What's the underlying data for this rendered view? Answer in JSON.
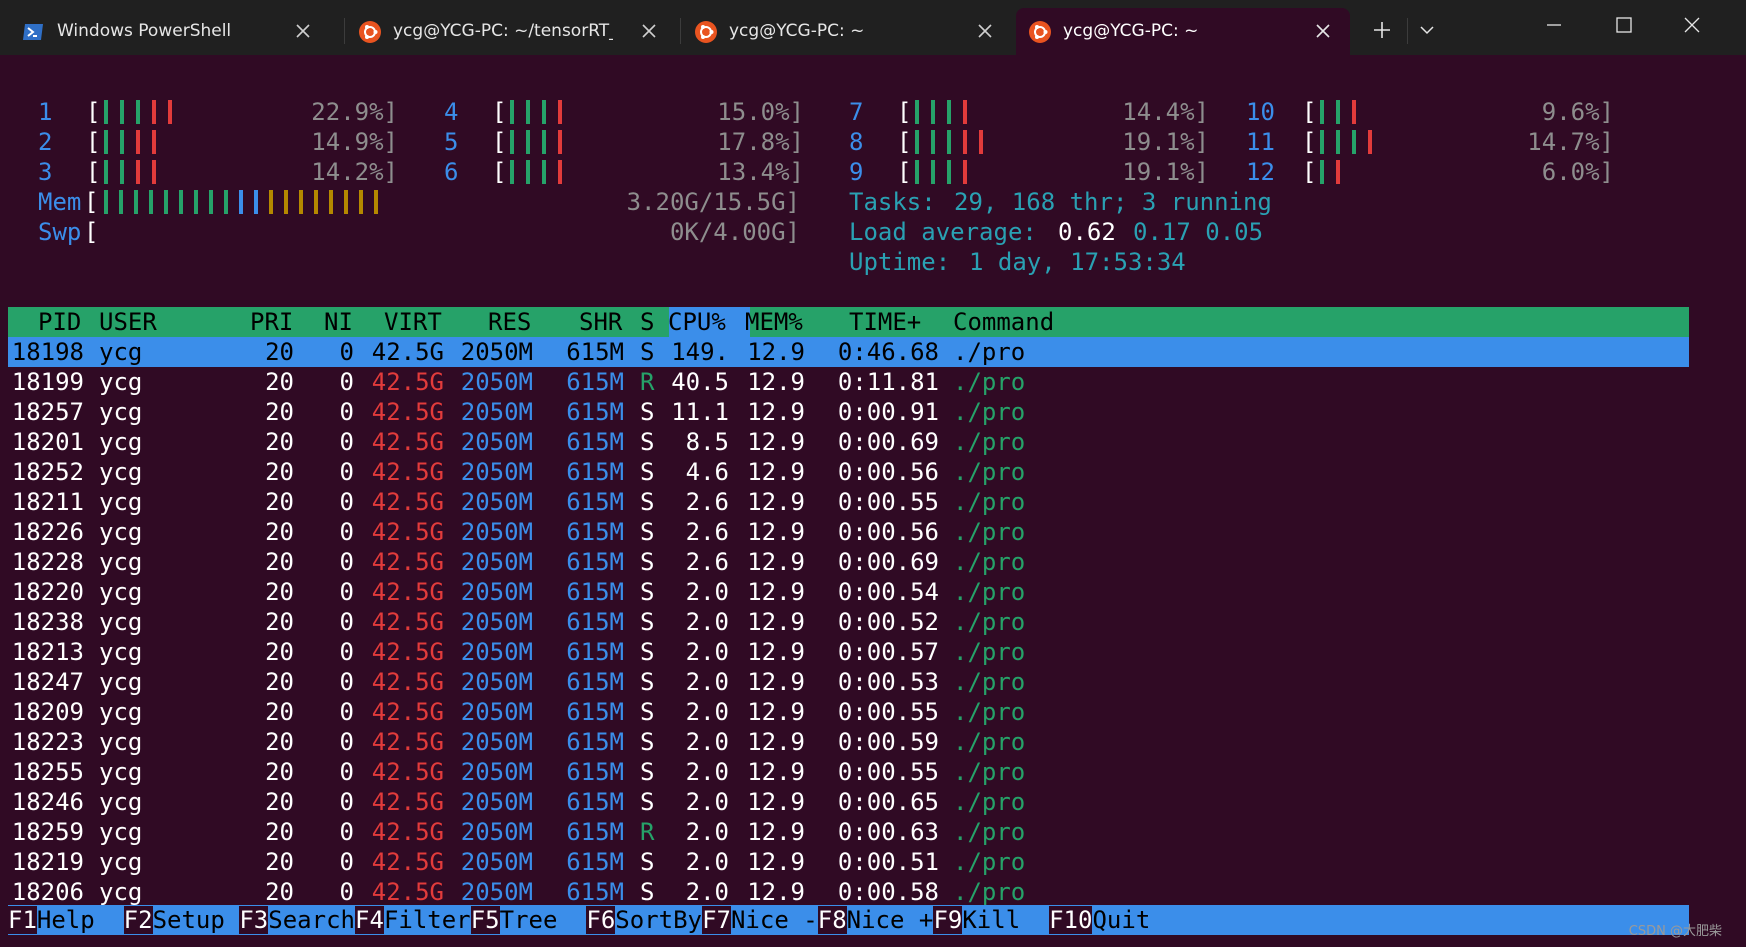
{
  "tabs": [
    {
      "label": "Windows PowerShell",
      "icon": "powershell-icon"
    },
    {
      "label": "ycg@YCG-PC: ~/tensorRT_F",
      "icon": "ubuntu-icon"
    },
    {
      "label": "ycg@YCG-PC: ~",
      "icon": "ubuntu-icon"
    },
    {
      "label": "ycg@YCG-PC: ~",
      "icon": "ubuntu-icon",
      "active": true
    }
  ],
  "cpus": [
    {
      "id": "1",
      "pct": "22.9%]"
    },
    {
      "id": "2",
      "pct": "14.9%]"
    },
    {
      "id": "3",
      "pct": "14.2%]"
    },
    {
      "id": "4",
      "pct": "15.0%]"
    },
    {
      "id": "5",
      "pct": "17.8%]"
    },
    {
      "id": "6",
      "pct": "13.4%]"
    },
    {
      "id": "7",
      "pct": "14.4%]"
    },
    {
      "id": "8",
      "pct": "19.1%]"
    },
    {
      "id": "9",
      "pct": "19.1%]"
    },
    {
      "id": "10",
      "pct": "9.6%]"
    },
    {
      "id": "11",
      "pct": "14.7%]"
    },
    {
      "id": "12",
      "pct": "6.0%]"
    }
  ],
  "mem": {
    "label": "Mem",
    "value": "3.20G/15.5G]"
  },
  "swp": {
    "label": "Swp",
    "value": "0K/4.00G]"
  },
  "summary": {
    "tasks_label": "Tasks:",
    "tasks_value": "29, 168 thr; 3 running",
    "load_label": "Load average:",
    "load_1": "0.62",
    "load_rest": "0.17 0.05",
    "uptime_label": "Uptime:",
    "uptime_value": "1 day, 17:53:34"
  },
  "columns": [
    "PID",
    "USER",
    "PRI",
    "NI",
    "VIRT",
    "RES",
    "SHR",
    "S",
    "CPU%",
    "MEM%",
    "TIME+",
    "Command"
  ],
  "processes": [
    {
      "pid": "18198",
      "user": "ycg",
      "pri": "20",
      "ni": "0",
      "virt": "42.5G",
      "res": "2050M",
      "shr": "615M",
      "s": "S",
      "cpu": "149.",
      "mem": "12.9",
      "time": "0:46.68",
      "cmd": "./pro"
    },
    {
      "pid": "18199",
      "user": "ycg",
      "pri": "20",
      "ni": "0",
      "virt": "42.5G",
      "res": "2050M",
      "shr": "615M",
      "s": "R",
      "cpu": "40.5",
      "mem": "12.9",
      "time": "0:11.81",
      "cmd": "./pro"
    },
    {
      "pid": "18257",
      "user": "ycg",
      "pri": "20",
      "ni": "0",
      "virt": "42.5G",
      "res": "2050M",
      "shr": "615M",
      "s": "S",
      "cpu": "11.1",
      "mem": "12.9",
      "time": "0:00.91",
      "cmd": "./pro"
    },
    {
      "pid": "18201",
      "user": "ycg",
      "pri": "20",
      "ni": "0",
      "virt": "42.5G",
      "res": "2050M",
      "shr": "615M",
      "s": "S",
      "cpu": "8.5",
      "mem": "12.9",
      "time": "0:00.69",
      "cmd": "./pro"
    },
    {
      "pid": "18252",
      "user": "ycg",
      "pri": "20",
      "ni": "0",
      "virt": "42.5G",
      "res": "2050M",
      "shr": "615M",
      "s": "S",
      "cpu": "4.6",
      "mem": "12.9",
      "time": "0:00.56",
      "cmd": "./pro"
    },
    {
      "pid": "18211",
      "user": "ycg",
      "pri": "20",
      "ni": "0",
      "virt": "42.5G",
      "res": "2050M",
      "shr": "615M",
      "s": "S",
      "cpu": "2.6",
      "mem": "12.9",
      "time": "0:00.55",
      "cmd": "./pro"
    },
    {
      "pid": "18226",
      "user": "ycg",
      "pri": "20",
      "ni": "0",
      "virt": "42.5G",
      "res": "2050M",
      "shr": "615M",
      "s": "S",
      "cpu": "2.6",
      "mem": "12.9",
      "time": "0:00.56",
      "cmd": "./pro"
    },
    {
      "pid": "18228",
      "user": "ycg",
      "pri": "20",
      "ni": "0",
      "virt": "42.5G",
      "res": "2050M",
      "shr": "615M",
      "s": "S",
      "cpu": "2.6",
      "mem": "12.9",
      "time": "0:00.69",
      "cmd": "./pro"
    },
    {
      "pid": "18220",
      "user": "ycg",
      "pri": "20",
      "ni": "0",
      "virt": "42.5G",
      "res": "2050M",
      "shr": "615M",
      "s": "S",
      "cpu": "2.0",
      "mem": "12.9",
      "time": "0:00.54",
      "cmd": "./pro"
    },
    {
      "pid": "18238",
      "user": "ycg",
      "pri": "20",
      "ni": "0",
      "virt": "42.5G",
      "res": "2050M",
      "shr": "615M",
      "s": "S",
      "cpu": "2.0",
      "mem": "12.9",
      "time": "0:00.52",
      "cmd": "./pro"
    },
    {
      "pid": "18213",
      "user": "ycg",
      "pri": "20",
      "ni": "0",
      "virt": "42.5G",
      "res": "2050M",
      "shr": "615M",
      "s": "S",
      "cpu": "2.0",
      "mem": "12.9",
      "time": "0:00.57",
      "cmd": "./pro"
    },
    {
      "pid": "18247",
      "user": "ycg",
      "pri": "20",
      "ni": "0",
      "virt": "42.5G",
      "res": "2050M",
      "shr": "615M",
      "s": "S",
      "cpu": "2.0",
      "mem": "12.9",
      "time": "0:00.53",
      "cmd": "./pro"
    },
    {
      "pid": "18209",
      "user": "ycg",
      "pri": "20",
      "ni": "0",
      "virt": "42.5G",
      "res": "2050M",
      "shr": "615M",
      "s": "S",
      "cpu": "2.0",
      "mem": "12.9",
      "time": "0:00.55",
      "cmd": "./pro"
    },
    {
      "pid": "18223",
      "user": "ycg",
      "pri": "20",
      "ni": "0",
      "virt": "42.5G",
      "res": "2050M",
      "shr": "615M",
      "s": "S",
      "cpu": "2.0",
      "mem": "12.9",
      "time": "0:00.59",
      "cmd": "./pro"
    },
    {
      "pid": "18255",
      "user": "ycg",
      "pri": "20",
      "ni": "0",
      "virt": "42.5G",
      "res": "2050M",
      "shr": "615M",
      "s": "S",
      "cpu": "2.0",
      "mem": "12.9",
      "time": "0:00.55",
      "cmd": "./pro"
    },
    {
      "pid": "18246",
      "user": "ycg",
      "pri": "20",
      "ni": "0",
      "virt": "42.5G",
      "res": "2050M",
      "shr": "615M",
      "s": "S",
      "cpu": "2.0",
      "mem": "12.9",
      "time": "0:00.65",
      "cmd": "./pro"
    },
    {
      "pid": "18259",
      "user": "ycg",
      "pri": "20",
      "ni": "0",
      "virt": "42.5G",
      "res": "2050M",
      "shr": "615M",
      "s": "R",
      "cpu": "2.0",
      "mem": "12.9",
      "time": "0:00.63",
      "cmd": "./pro"
    },
    {
      "pid": "18219",
      "user": "ycg",
      "pri": "20",
      "ni": "0",
      "virt": "42.5G",
      "res": "2050M",
      "shr": "615M",
      "s": "S",
      "cpu": "2.0",
      "mem": "12.9",
      "time": "0:00.51",
      "cmd": "./pro"
    },
    {
      "pid": "18206",
      "user": "ycg",
      "pri": "20",
      "ni": "0",
      "virt": "42.5G",
      "res": "2050M",
      "shr": "615M",
      "s": "S",
      "cpu": "2.0",
      "mem": "12.9",
      "time": "0:00.58",
      "cmd": "./pro"
    }
  ],
  "fkeys": [
    {
      "key": "F1",
      "label": "Help  "
    },
    {
      "key": "F2",
      "label": "Setup "
    },
    {
      "key": "F3",
      "label": "Search"
    },
    {
      "key": "F4",
      "label": "Filter"
    },
    {
      "key": "F5",
      "label": "Tree  "
    },
    {
      "key": "F6",
      "label": "SortBy"
    },
    {
      "key": "F7",
      "label": "Nice -"
    },
    {
      "key": "F8",
      "label": "Nice +"
    },
    {
      "key": "F9",
      "label": "Kill  "
    },
    {
      "key": "F10",
      "label": "Quit"
    }
  ],
  "watermark": "CSDN @大肥柴",
  "colors": {
    "background": "#300a24",
    "header": "#26a269",
    "selection": "#3b8eea",
    "accent_red": "#e23b3b"
  }
}
